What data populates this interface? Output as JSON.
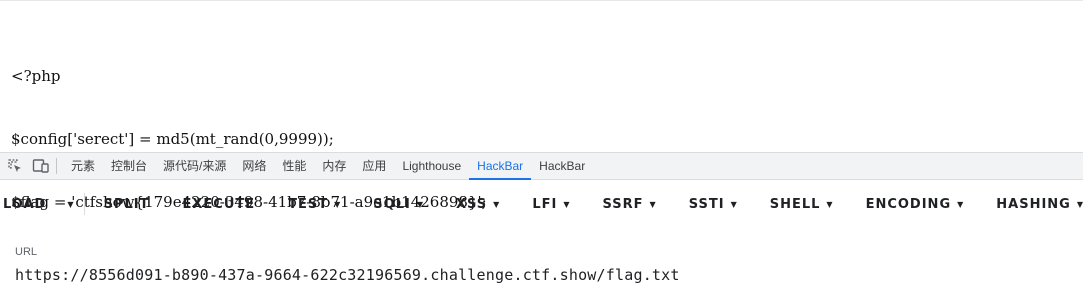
{
  "code_lines": [
    "<?php",
    "$config['serect'] = md5(mt_rand(0,9999));",
    "$flag = 'ctfshow{179e4220-3498-41b7-8b71-a9e1b1426898}';"
  ],
  "devtools": {
    "tabs": [
      "元素",
      "控制台",
      "源代码/来源",
      "网络",
      "性能",
      "内存",
      "应用",
      "Lighthouse",
      "HackBar",
      "HackBar"
    ],
    "active_tab_index": 8,
    "icons": [
      "inspect-element-icon",
      "device-toolbar-icon"
    ]
  },
  "hackbar": {
    "buttons": [
      {
        "label": "LOAD",
        "dropdown": false
      },
      {
        "label": "SPLIT",
        "dropdown": false
      },
      {
        "label": "EXECUTE",
        "dropdown": false
      },
      {
        "label": "TEST",
        "dropdown": true
      },
      {
        "label": "SQLI",
        "dropdown": true
      },
      {
        "label": "XSS",
        "dropdown": true
      },
      {
        "label": "LFI",
        "dropdown": true
      },
      {
        "label": "SSRF",
        "dropdown": true
      },
      {
        "label": "SSTI",
        "dropdown": true
      },
      {
        "label": "SHELL",
        "dropdown": true
      },
      {
        "label": "ENCODING",
        "dropdown": true
      },
      {
        "label": "HASHING",
        "dropdown": true
      }
    ],
    "url_label": "URL",
    "url_value": "https://8556d091-b890-437a-9664-622c32196569.challenge.ctf.show/flag.txt"
  },
  "colors": {
    "accent": "#1a73e8"
  }
}
